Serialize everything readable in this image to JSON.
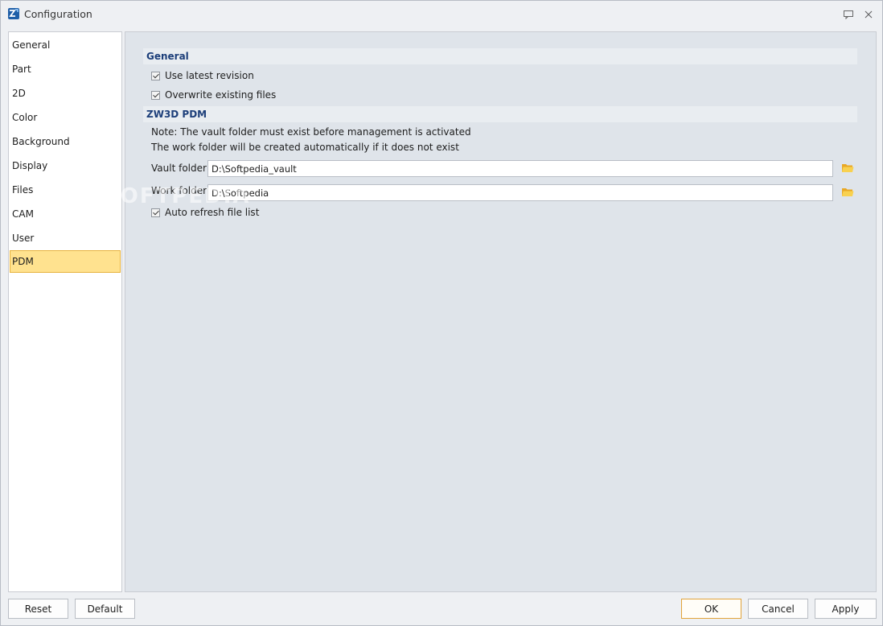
{
  "window": {
    "title": "Configuration",
    "icon": "zw3d-logo-icon"
  },
  "sidebar": {
    "items": [
      {
        "label": "General"
      },
      {
        "label": "Part"
      },
      {
        "label": "2D"
      },
      {
        "label": "Color"
      },
      {
        "label": "Background"
      },
      {
        "label": "Display"
      },
      {
        "label": "Files"
      },
      {
        "label": "CAM"
      },
      {
        "label": "User"
      },
      {
        "label": "PDM",
        "selected": true
      }
    ]
  },
  "general_section": {
    "title": "General",
    "use_latest_revision": {
      "label": "Use latest revision",
      "checked": true
    },
    "overwrite_existing": {
      "label": "Overwrite existing files",
      "checked": true
    }
  },
  "pdm_section": {
    "title": "ZW3D PDM",
    "note_line1": "Note: The vault folder must exist before management is activated",
    "note_line2": "The work folder will be created automatically if it does not exist",
    "vault_folder": {
      "label": "Vault folder",
      "value": "D:\\Softpedia_vault"
    },
    "work_folder": {
      "label": "Work folder",
      "value": "D:\\Softpedia"
    },
    "auto_refresh": {
      "label": "Auto refresh file list",
      "checked": true
    }
  },
  "watermark": "SOFTPEDIA",
  "buttons": {
    "reset": "Reset",
    "default": "Default",
    "ok": "OK",
    "cancel": "Cancel",
    "apply": "Apply"
  },
  "colors": {
    "accent": "#ffe28f",
    "accent_border": "#e7b23c",
    "section_title": "#1d3f7a",
    "panel_bg": "#dfe4ea"
  }
}
